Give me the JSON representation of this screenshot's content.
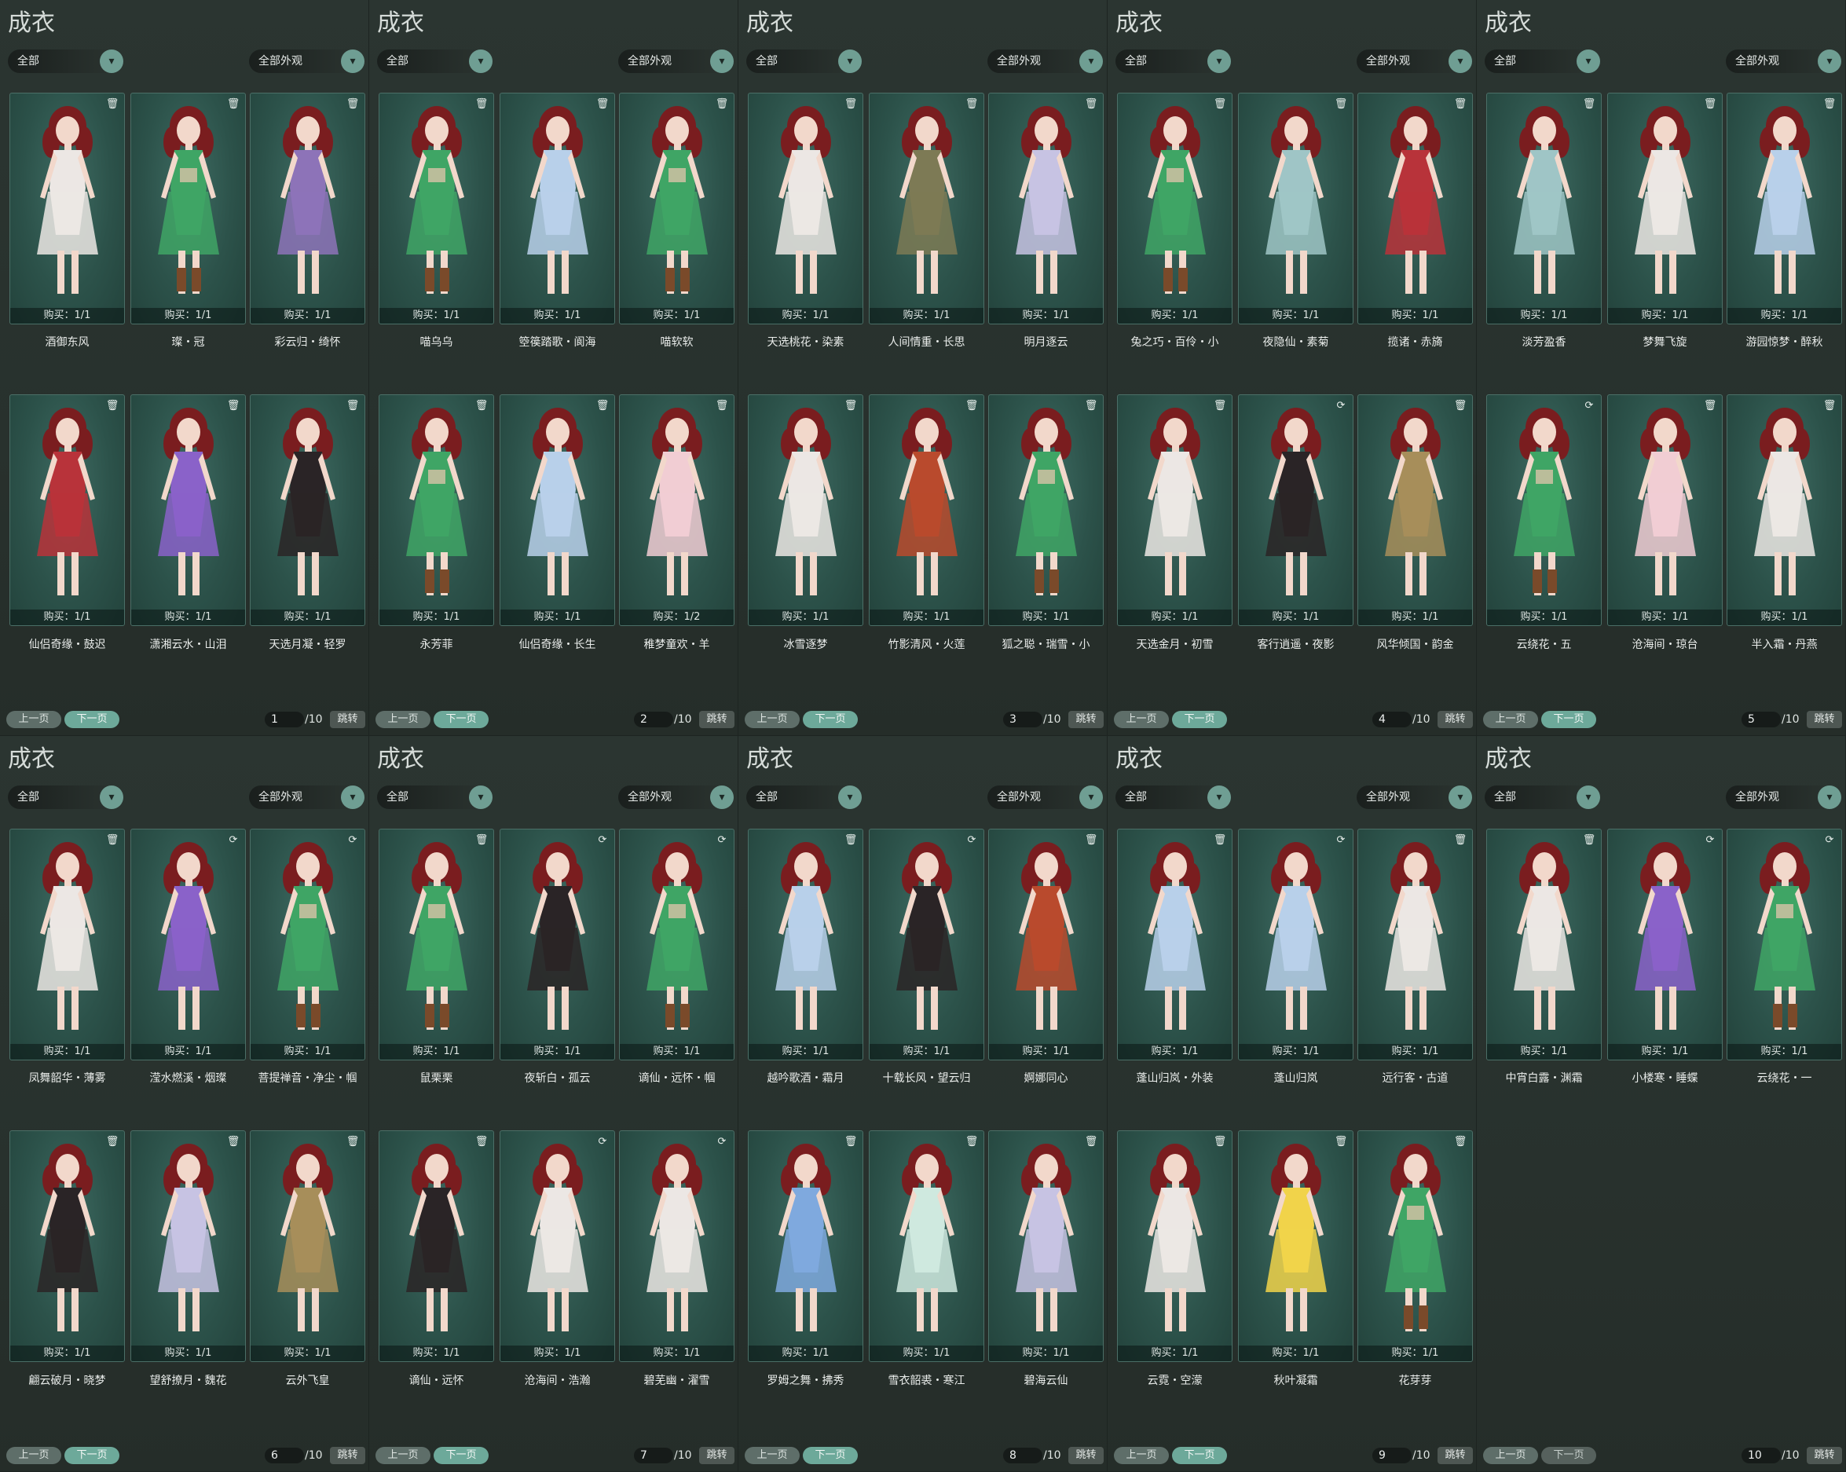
{
  "pages": [
    {
      "title": "成衣",
      "category_filter": "全部",
      "appearance_filter": "全部外观",
      "prev_label": "上一页",
      "next_label": "下一页",
      "page": "1",
      "total": "/10",
      "jump_label": "跳转",
      "items": [
        {
          "name": "酒御东风",
          "buy": "购买：1/1",
          "outfit": "white",
          "icon": "trash-icon"
        },
        {
          "name": "璨・冠",
          "buy": "购买：1/1",
          "outfit": "green",
          "icon": "trash-icon"
        },
        {
          "name": "彩云归・绮怀",
          "buy": "购买：1/1",
          "outfit": "purple",
          "icon": "trash-icon"
        },
        {
          "name": "仙侣奇缘・鼓迟",
          "buy": "购买：1/1",
          "outfit": "red",
          "icon": "trash-icon"
        },
        {
          "name": "潇湘云水・山泪",
          "buy": "购买：1/1",
          "outfit": "violet",
          "icon": "trash-icon"
        },
        {
          "name": "天选月凝・轻罗",
          "buy": "购买：1/1",
          "outfit": "black",
          "icon": "trash-icon"
        }
      ]
    },
    {
      "title": "成衣",
      "category_filter": "全部",
      "appearance_filter": "全部外观",
      "prev_label": "上一页",
      "next_label": "下一页",
      "page": "2",
      "total": "/10",
      "jump_label": "跳转",
      "items": [
        {
          "name": "喵乌乌",
          "buy": "购买：1/1",
          "outfit": "green",
          "icon": "trash-icon"
        },
        {
          "name": "箜篌踏歌・阆海",
          "buy": "购买：1/1",
          "outfit": "lightblue",
          "icon": "trash-icon"
        },
        {
          "name": "喵软软",
          "buy": "购买：1/1",
          "outfit": "green",
          "icon": "trash-icon"
        },
        {
          "name": "永芳菲",
          "buy": "购买：1/1",
          "outfit": "green",
          "icon": "trash-icon"
        },
        {
          "name": "仙侣奇缘・长生",
          "buy": "购买：1/1",
          "outfit": "lightblue",
          "icon": "trash-icon"
        },
        {
          "name": "稚梦童欢・羊",
          "buy": "购买：1/2",
          "outfit": "pink",
          "icon": "trash-icon"
        }
      ]
    },
    {
      "title": "成衣",
      "category_filter": "全部",
      "appearance_filter": "全部外观",
      "prev_label": "上一页",
      "next_label": "下一页",
      "page": "3",
      "total": "/10",
      "jump_label": "跳转",
      "items": [
        {
          "name": "天选桃花・染素",
          "buy": "购买：1/1",
          "outfit": "white",
          "icon": "trash-icon"
        },
        {
          "name": "人间情重・长思",
          "buy": "购买：1/1",
          "outfit": "olive",
          "icon": "trash-icon"
        },
        {
          "name": "明月逐云",
          "buy": "购买：1/1",
          "outfit": "lavender",
          "icon": "trash-icon"
        },
        {
          "name": "冰雪逐梦",
          "buy": "购买：1/1",
          "outfit": "white",
          "icon": "trash-icon"
        },
        {
          "name": "竹影清风・火莲",
          "buy": "购买：1/1",
          "outfit": "redgold",
          "icon": "trash-icon"
        },
        {
          "name": "狐之聪・瑞雪・小",
          "buy": "购买：1/1",
          "outfit": "green",
          "icon": "trash-icon"
        }
      ]
    },
    {
      "title": "成衣",
      "category_filter": "全部",
      "appearance_filter": "全部外观",
      "prev_label": "上一页",
      "next_label": "下一页",
      "page": "4",
      "total": "/10",
      "jump_label": "跳转",
      "items": [
        {
          "name": "兔之巧・百伶・小",
          "buy": "购买：1/1",
          "outfit": "green",
          "icon": "trash-icon"
        },
        {
          "name": "夜隐仙・素菊",
          "buy": "购买：1/1",
          "outfit": "teal",
          "icon": "trash-icon"
        },
        {
          "name": "揽诸・赤旖",
          "buy": "购买：1/1",
          "outfit": "red",
          "icon": "trash-icon"
        },
        {
          "name": "天选金月・初雪",
          "buy": "购买：1/1",
          "outfit": "white",
          "icon": "trash-icon"
        },
        {
          "name": "客行逍遥・夜影",
          "buy": "购买：1/1",
          "outfit": "black",
          "icon": "swap-icon"
        },
        {
          "name": "风华倾国・韵金",
          "buy": "购买：1/1",
          "outfit": "gold",
          "icon": "trash-icon"
        }
      ]
    },
    {
      "title": "成衣",
      "category_filter": "全部",
      "appearance_filter": "全部外观",
      "prev_label": "上一页",
      "next_label": "下一页",
      "page": "5",
      "total": "/10",
      "jump_label": "跳转",
      "items": [
        {
          "name": "淡芳盈香",
          "buy": "购买：1/1",
          "outfit": "teal",
          "icon": "trash-icon"
        },
        {
          "name": "梦舞飞旋",
          "buy": "购买：1/1",
          "outfit": "white",
          "icon": "trash-icon"
        },
        {
          "name": "游园惊梦・醉秋",
          "buy": "购买：1/1",
          "outfit": "lightblue",
          "icon": "trash-icon"
        },
        {
          "name": "云绕花・五",
          "buy": "购买：1/1",
          "outfit": "green",
          "icon": "swap-icon"
        },
        {
          "name": "沧海间・琼台",
          "buy": "购买：1/1",
          "outfit": "pink",
          "icon": "trash-icon"
        },
        {
          "name": "半入霜・丹燕",
          "buy": "购买：1/1",
          "outfit": "white",
          "icon": "trash-icon"
        }
      ]
    },
    {
      "title": "成衣",
      "category_filter": "全部",
      "appearance_filter": "全部外观",
      "prev_label": "上一页",
      "next_label": "下一页",
      "page": "6",
      "total": "/10",
      "jump_label": "跳转",
      "items": [
        {
          "name": "凤舞韶华・薄雾",
          "buy": "购买：1/1",
          "outfit": "white",
          "icon": "trash-icon"
        },
        {
          "name": "滢水燃溪・烟璨",
          "buy": "购买：1/1",
          "outfit": "violet",
          "icon": "swap-icon"
        },
        {
          "name": "菩提禅音・净尘・帼",
          "buy": "购买：1/1",
          "outfit": "green",
          "icon": "swap-icon"
        },
        {
          "name": "翩云破月・晓梦",
          "buy": "购买：1/1",
          "outfit": "black",
          "icon": "trash-icon"
        },
        {
          "name": "望舒撩月・魏花",
          "buy": "购买：1/1",
          "outfit": "lavender",
          "icon": "trash-icon"
        },
        {
          "name": "云外飞皇",
          "buy": "购买：1/1",
          "outfit": "gold",
          "icon": "trash-icon"
        }
      ]
    },
    {
      "title": "成衣",
      "category_filter": "全部",
      "appearance_filter": "全部外观",
      "prev_label": "上一页",
      "next_label": "下一页",
      "page": "7",
      "total": "/10",
      "jump_label": "跳转",
      "items": [
        {
          "name": "鼠栗栗",
          "buy": "购买：1/1",
          "outfit": "green",
          "icon": "trash-icon"
        },
        {
          "name": "夜斩白・孤云",
          "buy": "购买：1/1",
          "outfit": "black",
          "icon": "swap-icon"
        },
        {
          "name": "谪仙・远怀・帼",
          "buy": "购买：1/1",
          "outfit": "green",
          "icon": "swap-icon"
        },
        {
          "name": "谪仙・远怀",
          "buy": "购买：1/1",
          "outfit": "black",
          "icon": "trash-icon"
        },
        {
          "name": "沧海间・浩瀚",
          "buy": "购买：1/1",
          "outfit": "white",
          "icon": "swap-icon"
        },
        {
          "name": "碧芜幽・濯雪",
          "buy": "购买：1/1",
          "outfit": "white",
          "icon": "swap-icon"
        }
      ]
    },
    {
      "title": "成衣",
      "category_filter": "全部",
      "appearance_filter": "全部外观",
      "prev_label": "上一页",
      "next_label": "下一页",
      "page": "8",
      "total": "/10",
      "jump_label": "跳转",
      "items": [
        {
          "name": "越吟歌酒・霜月",
          "buy": "购买：1/1",
          "outfit": "lightblue",
          "icon": "trash-icon"
        },
        {
          "name": "十载长风・望云归",
          "buy": "购买：1/1",
          "outfit": "black",
          "icon": "swap-icon"
        },
        {
          "name": "婀娜同心",
          "buy": "购买：1/1",
          "outfit": "redgold",
          "icon": "trash-icon"
        },
        {
          "name": "罗姆之舞・拂秀",
          "buy": "购买：1/1",
          "outfit": "blue",
          "icon": "trash-icon"
        },
        {
          "name": "雪衣韶裘・寒江",
          "buy": "购买：1/1",
          "outfit": "mint",
          "icon": "trash-icon"
        },
        {
          "name": "碧海云仙",
          "buy": "购买：1/1",
          "outfit": "lavender",
          "icon": "trash-icon"
        }
      ]
    },
    {
      "title": "成衣",
      "category_filter": "全部",
      "appearance_filter": "全部外观",
      "prev_label": "上一页",
      "next_label": "下一页",
      "page": "9",
      "total": "/10",
      "jump_label": "跳转",
      "items": [
        {
          "name": "蓬山归岚・外装",
          "buy": "购买：1/1",
          "outfit": "lightblue",
          "icon": "trash-icon"
        },
        {
          "name": "蓬山归岚",
          "buy": "购买：1/1",
          "outfit": "lightblue",
          "icon": "swap-icon"
        },
        {
          "name": "远行客・古道",
          "buy": "购买：1/1",
          "outfit": "white",
          "icon": "trash-icon"
        },
        {
          "name": "云霓・空濛",
          "buy": "购买：1/1",
          "outfit": "white",
          "icon": "trash-icon"
        },
        {
          "name": "秋叶凝霜",
          "buy": "购买：1/1",
          "outfit": "yellow",
          "icon": "trash-icon"
        },
        {
          "name": "花芽芽",
          "buy": "购买：1/1",
          "outfit": "green",
          "icon": "trash-icon"
        }
      ]
    },
    {
      "title": "成衣",
      "category_filter": "全部",
      "appearance_filter": "全部外观",
      "prev_label": "上一页",
      "next_label": "下一页",
      "page": "10",
      "total": "/10",
      "jump_label": "跳转",
      "items": [
        {
          "name": "中宵白露・渊霜",
          "buy": "购买：1/1",
          "outfit": "white",
          "icon": "trash-icon"
        },
        {
          "name": "小楼寒・睡蝶",
          "buy": "购买：1/1",
          "outfit": "violet",
          "icon": "swap-icon"
        },
        {
          "name": "云绕花・一",
          "buy": "购买：1/1",
          "outfit": "green",
          "icon": "swap-icon"
        }
      ]
    }
  ],
  "outfit_colors": {
    "white": "#ece7e4",
    "green": "#3fa565",
    "purple": "#8d73b8",
    "red": "#b8333a",
    "violet": "#8a62c9",
    "black": "#2a2426",
    "lightblue": "#b8d0ea",
    "pink": "#f1cdd3",
    "olive": "#7d7a55",
    "lavender": "#c7c3e3",
    "redgold": "#b94a2d",
    "teal": "#9fc5c6",
    "gold": "#a78e5a",
    "blue": "#7fa9de",
    "mint": "#cfe9df",
    "yellow": "#f1d34a"
  },
  "hair_color": "#7a1d1f",
  "skin_color": "#f2d8cb"
}
